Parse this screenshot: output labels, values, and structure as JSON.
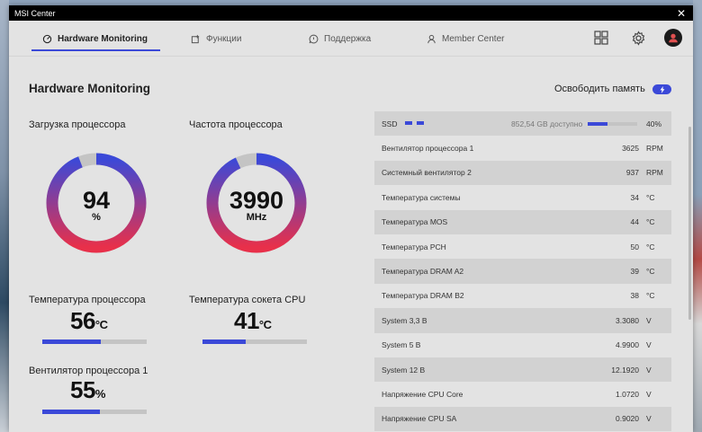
{
  "window": {
    "title": "MSI Center",
    "close_glyph": "✕"
  },
  "nav": {
    "tabs": [
      {
        "label": "Hardware Monitoring",
        "icon": "gauge-icon",
        "active": true
      },
      {
        "label": "Функции",
        "icon": "features-icon"
      },
      {
        "label": "Поддержка",
        "icon": "support-icon"
      },
      {
        "label": "Member Center",
        "icon": "member-icon"
      }
    ],
    "icons": [
      "grid-icon",
      "gear-icon",
      "avatar"
    ]
  },
  "page": {
    "title": "Hardware Monitoring",
    "free_memory_label": "Освободить память"
  },
  "cpu_load": {
    "label": "Загрузка процессора",
    "value": "94",
    "unit": "%",
    "fraction": 0.94
  },
  "cpu_freq": {
    "label": "Частота процессора",
    "value": "3990",
    "unit": "MHz",
    "fraction": 0.93
  },
  "cpu_temp": {
    "label": "Температура процессора",
    "value": "56",
    "unit": "°C",
    "fraction": 0.56
  },
  "socket_temp": {
    "label": "Температура сокета CPU",
    "value": "41",
    "unit": "°C",
    "fraction": 0.41
  },
  "cpu_fan": {
    "label": "Вентилятор процессора 1",
    "value": "55",
    "unit": "%",
    "fraction": 0.55
  },
  "ssd": {
    "name": "SSD",
    "available": "852,54 GB доступно",
    "percent": "40%",
    "fraction": 0.4
  },
  "sensors": [
    {
      "name": "Вентилятор процессора 1",
      "value": "3625",
      "unit": "RPM"
    },
    {
      "name": "Системный вентилятор 2",
      "value": "937",
      "unit": "RPM"
    },
    {
      "name": "Температура системы",
      "value": "34",
      "unit": "°C"
    },
    {
      "name": "Температура MOS",
      "value": "44",
      "unit": "°C"
    },
    {
      "name": "Температура PCH",
      "value": "50",
      "unit": "°C"
    },
    {
      "name": "Температура DRAM A2",
      "value": "39",
      "unit": "°C"
    },
    {
      "name": "Температура DRAM B2",
      "value": "38",
      "unit": "°C"
    },
    {
      "name": "System 3,3 В",
      "value": "3.3080",
      "unit": "V"
    },
    {
      "name": "System 5 В",
      "value": "4.9900",
      "unit": "V"
    },
    {
      "name": "System 12 В",
      "value": "12.1920",
      "unit": "V"
    },
    {
      "name": "Напряжение CPU Core",
      "value": "1.0720",
      "unit": "V"
    },
    {
      "name": "Напряжение CPU SA",
      "value": "0.9020",
      "unit": "V"
    }
  ],
  "colors": {
    "accent": "#3b49d8",
    "gradient_start": "#e8304a",
    "gradient_end": "#3b49d8",
    "track": "#c4c4c4"
  }
}
